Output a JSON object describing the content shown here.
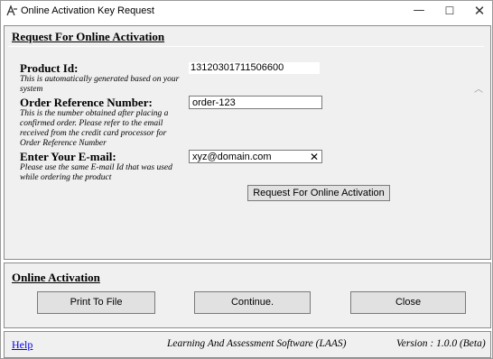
{
  "window": {
    "title": "Online Activation Key Request",
    "minimize_glyph": "—",
    "maximize_glyph": "☐",
    "close_glyph": "✕"
  },
  "request_section": {
    "heading": "Request For Online Activation",
    "product_id": {
      "label": "Product Id:",
      "hint": "This is automatically generated based on your system",
      "value": "13120301711506600"
    },
    "order_ref": {
      "label": "Order Reference Number:",
      "hint": "This is the number obtained after placing a confirmed order. Please refer to the email received from the credit card processor for Order Reference Number",
      "value": "order-123"
    },
    "email": {
      "label": "Enter Your E-mail:",
      "hint": "Please use the same E-mail Id that was used while ordering the product",
      "value": "xyz@domain.com",
      "clear_glyph": "✕"
    },
    "request_button": "Request For Online Activation",
    "scroll_up_glyph": "︿"
  },
  "activation_section": {
    "heading": "Online Activation",
    "print_button": "Print To File",
    "continue_button": "Continue.",
    "close_button": "Close"
  },
  "footer": {
    "help": "Help",
    "product_name": "Learning And Assessment Software (LAAS)",
    "version": "Version : 1.0.0 (Beta)"
  },
  "icons": {
    "app": "app-logo-icon",
    "scroll": "chevron-up-icon",
    "clear": "close-icon"
  }
}
